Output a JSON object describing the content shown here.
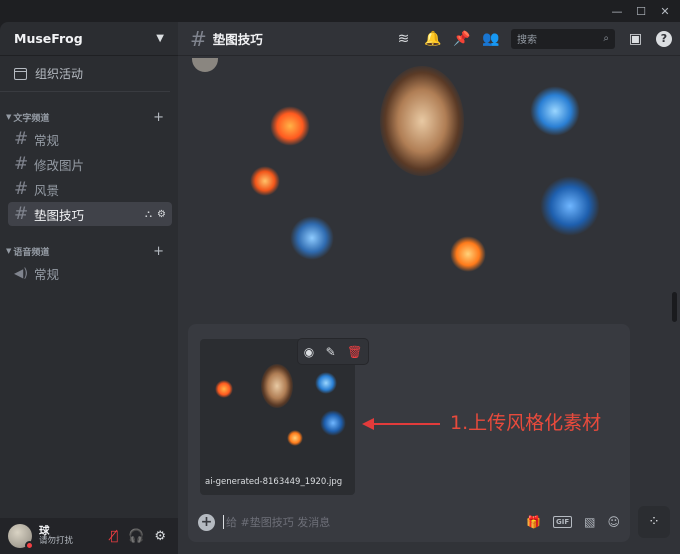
{
  "window": {
    "minimize_label": "—",
    "maximize_label": "☐",
    "close_label": "✕"
  },
  "sidebar": {
    "server_name": "MuseFrog",
    "events_label": "组织活动",
    "text_category": "文字频道",
    "voice_category": "语音频道",
    "text_channels": [
      {
        "name": "常规"
      },
      {
        "name": "修改图片"
      },
      {
        "name": "风景"
      },
      {
        "name": "垫图技巧"
      }
    ],
    "voice_channels": [
      {
        "name": "常规"
      }
    ]
  },
  "user": {
    "name": "球",
    "status": "请勿打扰"
  },
  "header": {
    "channel_name": "垫图技巧",
    "search_placeholder": "搜索"
  },
  "attachment": {
    "filename": "ai-generated-8163449_1920.jpg"
  },
  "composer": {
    "placeholder": "给 #垫图技巧 发消息",
    "gif_label": "GIF"
  },
  "annotation": {
    "text": "1.上传风格化素材",
    "color": "#e84a3c"
  },
  "colors": {
    "background": "#313338",
    "sidebar": "#2b2d31",
    "active_channel": "#404249",
    "danger": "#f23f43"
  }
}
